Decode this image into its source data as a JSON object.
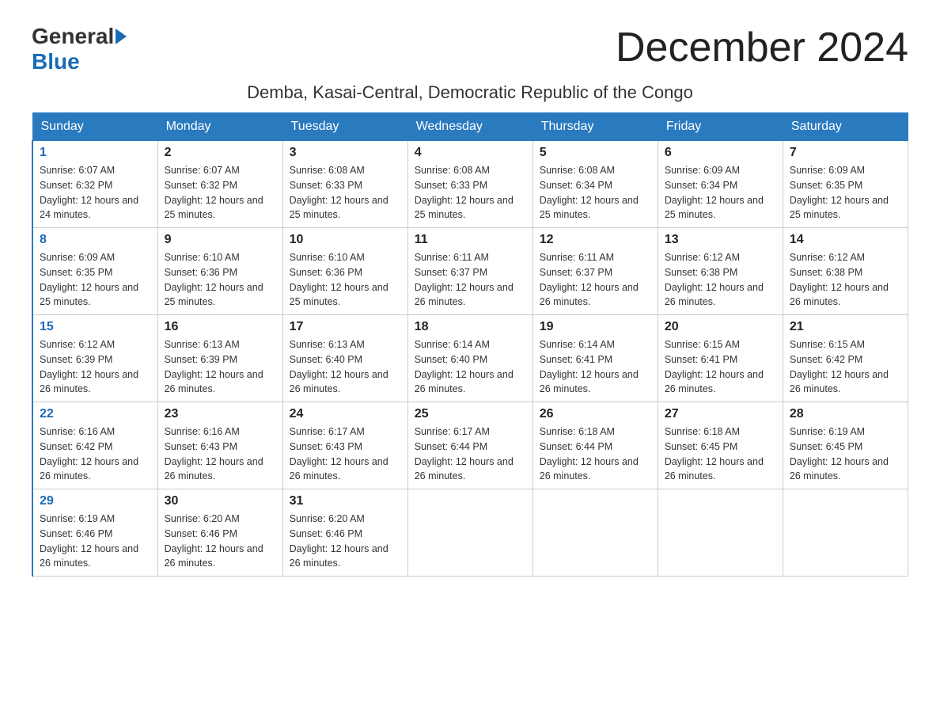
{
  "header": {
    "logo_general": "General",
    "logo_blue": "Blue",
    "month_title": "December 2024",
    "location": "Demba, Kasai-Central, Democratic Republic of the Congo"
  },
  "days_of_week": [
    "Sunday",
    "Monday",
    "Tuesday",
    "Wednesday",
    "Thursday",
    "Friday",
    "Saturday"
  ],
  "weeks": [
    [
      {
        "day": "1",
        "sunrise": "6:07 AM",
        "sunset": "6:32 PM",
        "daylight": "12 hours and 24 minutes."
      },
      {
        "day": "2",
        "sunrise": "6:07 AM",
        "sunset": "6:32 PM",
        "daylight": "12 hours and 25 minutes."
      },
      {
        "day": "3",
        "sunrise": "6:08 AM",
        "sunset": "6:33 PM",
        "daylight": "12 hours and 25 minutes."
      },
      {
        "day": "4",
        "sunrise": "6:08 AM",
        "sunset": "6:33 PM",
        "daylight": "12 hours and 25 minutes."
      },
      {
        "day": "5",
        "sunrise": "6:08 AM",
        "sunset": "6:34 PM",
        "daylight": "12 hours and 25 minutes."
      },
      {
        "day": "6",
        "sunrise": "6:09 AM",
        "sunset": "6:34 PM",
        "daylight": "12 hours and 25 minutes."
      },
      {
        "day": "7",
        "sunrise": "6:09 AM",
        "sunset": "6:35 PM",
        "daylight": "12 hours and 25 minutes."
      }
    ],
    [
      {
        "day": "8",
        "sunrise": "6:09 AM",
        "sunset": "6:35 PM",
        "daylight": "12 hours and 25 minutes."
      },
      {
        "day": "9",
        "sunrise": "6:10 AM",
        "sunset": "6:36 PM",
        "daylight": "12 hours and 25 minutes."
      },
      {
        "day": "10",
        "sunrise": "6:10 AM",
        "sunset": "6:36 PM",
        "daylight": "12 hours and 25 minutes."
      },
      {
        "day": "11",
        "sunrise": "6:11 AM",
        "sunset": "6:37 PM",
        "daylight": "12 hours and 26 minutes."
      },
      {
        "day": "12",
        "sunrise": "6:11 AM",
        "sunset": "6:37 PM",
        "daylight": "12 hours and 26 minutes."
      },
      {
        "day": "13",
        "sunrise": "6:12 AM",
        "sunset": "6:38 PM",
        "daylight": "12 hours and 26 minutes."
      },
      {
        "day": "14",
        "sunrise": "6:12 AM",
        "sunset": "6:38 PM",
        "daylight": "12 hours and 26 minutes."
      }
    ],
    [
      {
        "day": "15",
        "sunrise": "6:12 AM",
        "sunset": "6:39 PM",
        "daylight": "12 hours and 26 minutes."
      },
      {
        "day": "16",
        "sunrise": "6:13 AM",
        "sunset": "6:39 PM",
        "daylight": "12 hours and 26 minutes."
      },
      {
        "day": "17",
        "sunrise": "6:13 AM",
        "sunset": "6:40 PM",
        "daylight": "12 hours and 26 minutes."
      },
      {
        "day": "18",
        "sunrise": "6:14 AM",
        "sunset": "6:40 PM",
        "daylight": "12 hours and 26 minutes."
      },
      {
        "day": "19",
        "sunrise": "6:14 AM",
        "sunset": "6:41 PM",
        "daylight": "12 hours and 26 minutes."
      },
      {
        "day": "20",
        "sunrise": "6:15 AM",
        "sunset": "6:41 PM",
        "daylight": "12 hours and 26 minutes."
      },
      {
        "day": "21",
        "sunrise": "6:15 AM",
        "sunset": "6:42 PM",
        "daylight": "12 hours and 26 minutes."
      }
    ],
    [
      {
        "day": "22",
        "sunrise": "6:16 AM",
        "sunset": "6:42 PM",
        "daylight": "12 hours and 26 minutes."
      },
      {
        "day": "23",
        "sunrise": "6:16 AM",
        "sunset": "6:43 PM",
        "daylight": "12 hours and 26 minutes."
      },
      {
        "day": "24",
        "sunrise": "6:17 AM",
        "sunset": "6:43 PM",
        "daylight": "12 hours and 26 minutes."
      },
      {
        "day": "25",
        "sunrise": "6:17 AM",
        "sunset": "6:44 PM",
        "daylight": "12 hours and 26 minutes."
      },
      {
        "day": "26",
        "sunrise": "6:18 AM",
        "sunset": "6:44 PM",
        "daylight": "12 hours and 26 minutes."
      },
      {
        "day": "27",
        "sunrise": "6:18 AM",
        "sunset": "6:45 PM",
        "daylight": "12 hours and 26 minutes."
      },
      {
        "day": "28",
        "sunrise": "6:19 AM",
        "sunset": "6:45 PM",
        "daylight": "12 hours and 26 minutes."
      }
    ],
    [
      {
        "day": "29",
        "sunrise": "6:19 AM",
        "sunset": "6:46 PM",
        "daylight": "12 hours and 26 minutes."
      },
      {
        "day": "30",
        "sunrise": "6:20 AM",
        "sunset": "6:46 PM",
        "daylight": "12 hours and 26 minutes."
      },
      {
        "day": "31",
        "sunrise": "6:20 AM",
        "sunset": "6:46 PM",
        "daylight": "12 hours and 26 minutes."
      },
      null,
      null,
      null,
      null
    ]
  ]
}
